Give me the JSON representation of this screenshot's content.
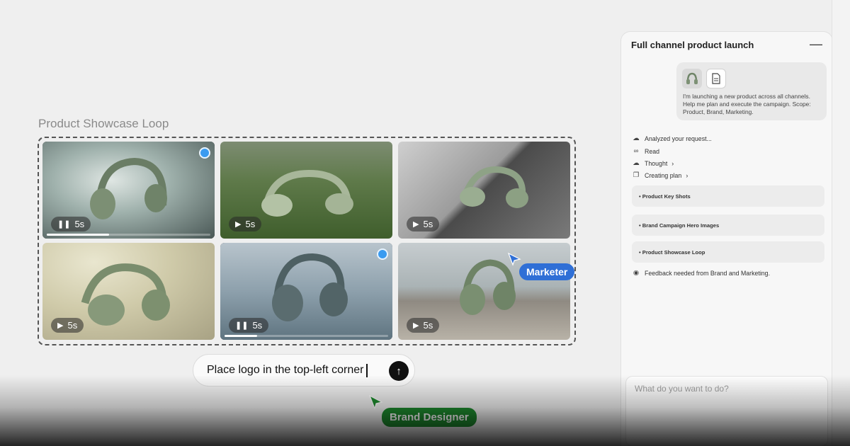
{
  "canvas": {
    "section_title": "Product Showcase Loop",
    "tiles": [
      {
        "id": "t1",
        "badge_icon": "pause-icon",
        "duration": "5s",
        "selected": true,
        "progress": 0.38,
        "bg": "snow"
      },
      {
        "id": "t2",
        "badge_icon": "play-icon",
        "duration": "5s",
        "selected": false,
        "progress": null,
        "bg": "grass"
      },
      {
        "id": "t3",
        "badge_icon": "play-icon",
        "duration": "5s",
        "selected": false,
        "progress": null,
        "bg": "stone"
      },
      {
        "id": "t4",
        "badge_icon": "play-icon",
        "duration": "5s",
        "selected": false,
        "progress": null,
        "bg": "silk"
      },
      {
        "id": "t5",
        "badge_icon": "pause-icon",
        "duration": "5s",
        "selected": true,
        "progress": 0.2,
        "bg": "rain"
      },
      {
        "id": "t6",
        "badge_icon": "play-icon",
        "duration": "5s",
        "selected": false,
        "progress": null,
        "bg": "driftwood"
      }
    ],
    "prompt": {
      "value": "Place logo in the top-left corner"
    },
    "cursors": {
      "marketer": {
        "label": "Marketer",
        "color": "#2f6fd6"
      },
      "brand_designer": {
        "label": "Brand Designer",
        "color": "#1e8a2e"
      }
    }
  },
  "panel": {
    "title": "Full channel product launch",
    "message": "I'm launching a new product across all channels. Help me plan and execute the campaign. Scope: Product, Brand, Marketing.",
    "steps": [
      {
        "icon": "brain-icon",
        "label": "Analyzed your request..."
      },
      {
        "icon": "infinity-icon",
        "label": "Read"
      },
      {
        "icon": "brain-icon",
        "label": "Thought",
        "chevron": "›"
      },
      {
        "icon": "copy-icon",
        "label": "Creating plan",
        "chevron": "›"
      }
    ],
    "plan_items": [
      "• Product Key Shots",
      "• Brand Campaign Hero Images",
      "• Product Showcase Loop"
    ],
    "feedback": "Feedback needed from Brand and Marketing.",
    "composer_placeholder": "What do you want to do?",
    "minimize_glyph": "—"
  }
}
